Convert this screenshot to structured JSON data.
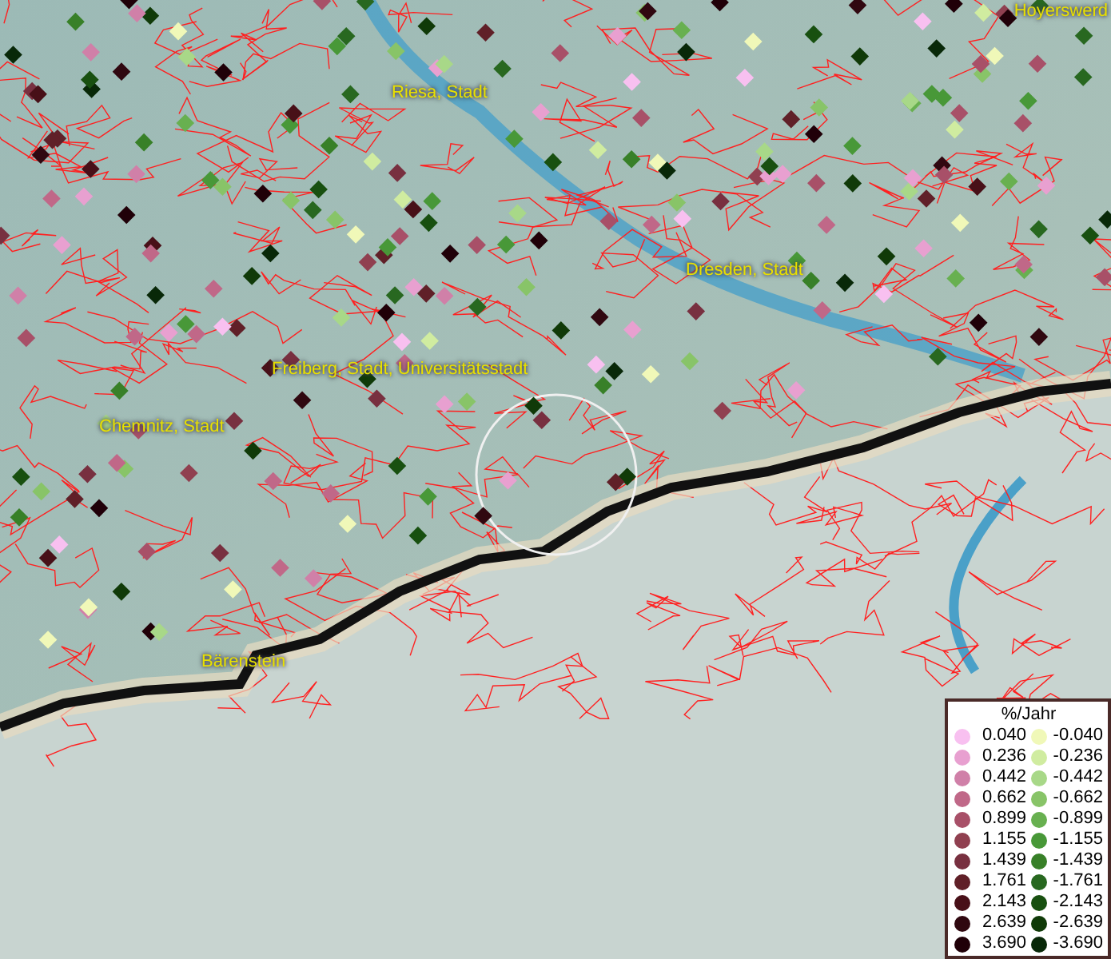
{
  "map_labels": [
    {
      "text": "Hoyerswerd"
    },
    {
      "text": "Riesa, Stadt"
    },
    {
      "text": "Dresden, Stadt"
    },
    {
      "text": "Freiberg, Stadt, Universitätsstadt"
    },
    {
      "text": "Chemnitz, Stadt"
    },
    {
      "text": "Bärenstein"
    }
  ],
  "legend": {
    "title": "%/Jahr",
    "rows": [
      {
        "pos": {
          "value": "0.040",
          "color": "#f8c0f0"
        },
        "neg": {
          "value": "-0.040",
          "color": "#f0f8b8"
        }
      },
      {
        "pos": {
          "value": "0.236",
          "color": "#e8a0d0"
        },
        "neg": {
          "value": "-0.236",
          "color": "#d0eca0"
        }
      },
      {
        "pos": {
          "value": "0.442",
          "color": "#d080a8"
        },
        "neg": {
          "value": "-0.442",
          "color": "#a8d888"
        }
      },
      {
        "pos": {
          "value": "0.662",
          "color": "#c06888"
        },
        "neg": {
          "value": "-0.662",
          "color": "#88c468"
        }
      },
      {
        "pos": {
          "value": "0.899",
          "color": "#a85068"
        },
        "neg": {
          "value": "-0.899",
          "color": "#68b050"
        }
      },
      {
        "pos": {
          "value": "1.155",
          "color": "#904050"
        },
        "neg": {
          "value": "-1.155",
          "color": "#489838"
        }
      },
      {
        "pos": {
          "value": "1.439",
          "color": "#783040"
        },
        "neg": {
          "value": "-1.439",
          "color": "#388028"
        }
      },
      {
        "pos": {
          "value": "1.761",
          "color": "#602028"
        },
        "neg": {
          "value": "-1.761",
          "color": "#286820"
        }
      },
      {
        "pos": {
          "value": "2.143",
          "color": "#481018"
        },
        "neg": {
          "value": "-2.143",
          "color": "#185010"
        }
      },
      {
        "pos": {
          "value": "2.639",
          "color": "#300810"
        },
        "neg": {
          "value": "-2.639",
          "color": "#103a08"
        }
      },
      {
        "pos": {
          "value": "3.690",
          "color": "#200008"
        },
        "neg": {
          "value": "-3.690",
          "color": "#082808"
        }
      }
    ]
  }
}
